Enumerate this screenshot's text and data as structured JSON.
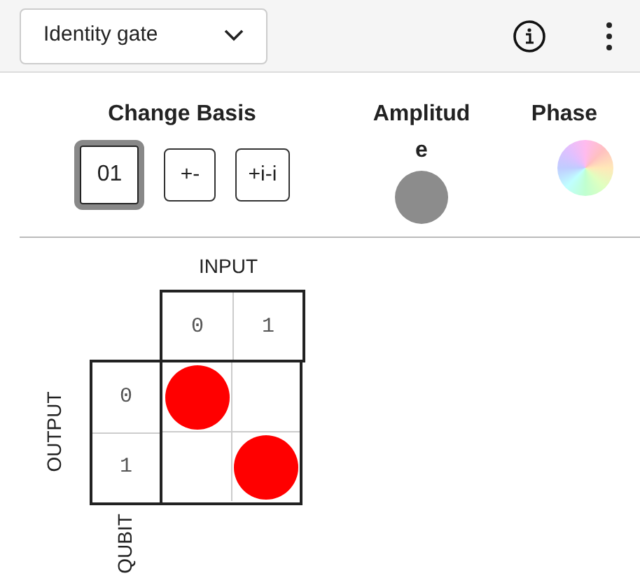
{
  "toolbar": {
    "gate_select": {
      "value": "Identity gate"
    }
  },
  "controls": {
    "basis_title": "Change Basis",
    "basis_buttons": [
      {
        "label": "01",
        "selected": true
      },
      {
        "label": "+-",
        "selected": false
      },
      {
        "label": "+i-i",
        "selected": false
      }
    ],
    "amplitude_title": "Amplitud e",
    "phase_title": "Phase"
  },
  "matrix": {
    "input_label": "INPUT",
    "output_label": "OUTPUT",
    "qubit_label": "QUBIT",
    "input_states": [
      "0",
      "1"
    ],
    "output_states": [
      "0",
      "1"
    ],
    "rows": [
      {
        "cells": [
          {
            "filled": true
          },
          {
            "filled": false
          }
        ]
      },
      {
        "cells": [
          {
            "filled": false
          },
          {
            "filled": true
          }
        ]
      }
    ]
  }
}
